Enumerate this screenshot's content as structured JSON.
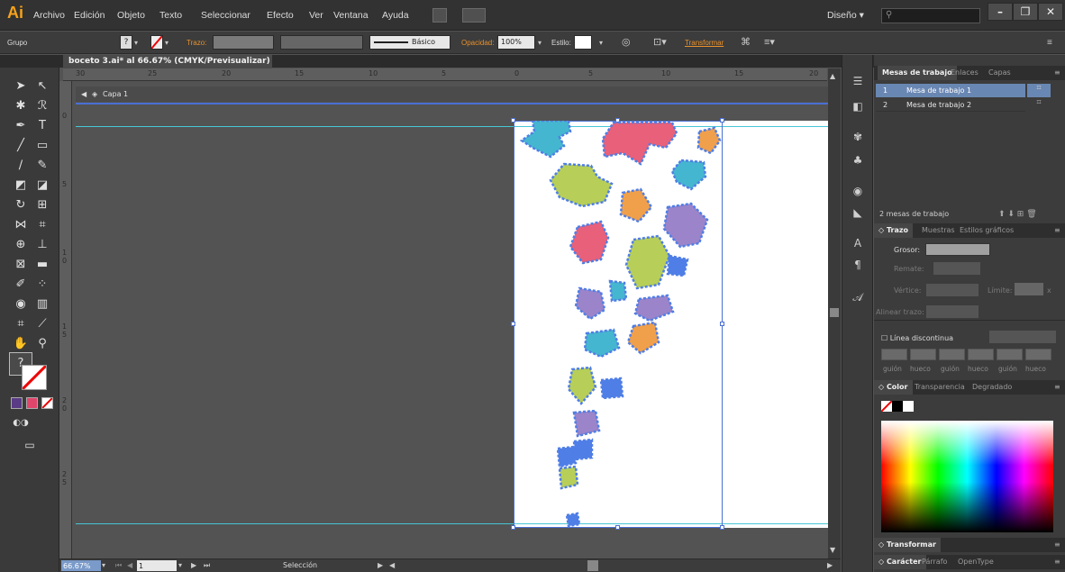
{
  "app": {
    "logo": "Ai",
    "workspace": "Diseño",
    "search_placeholder": ""
  },
  "menu": [
    "Archivo",
    "Edición",
    "Objeto",
    "Texto",
    "Seleccionar",
    "Efecto",
    "Ver",
    "Ventana",
    "Ayuda"
  ],
  "window_controls": {
    "minimize": "–",
    "restore": "❐",
    "close": "✕"
  },
  "control_bar": {
    "selection_label": "Grupo",
    "stroke_label": "Trazo:",
    "brush_label": "Básico",
    "opacity_label": "Opacidad:",
    "opacity_value": "100%",
    "style_label": "Estilo:",
    "transform_label": "Transformar"
  },
  "document": {
    "tab_title": "boceto 3.ai* al 66.67% (CMYK/Previsualizar)",
    "tab_close": "×",
    "layer_name": "Capa 1"
  },
  "rulers": {
    "h_ticks": [
      "30",
      "25",
      "20",
      "15",
      "10",
      "5",
      "0",
      "5",
      "10",
      "15",
      "20"
    ],
    "v_ticks": [
      "0",
      "5",
      "1 0",
      "1 5",
      "2 0",
      "2 5"
    ]
  },
  "status": {
    "zoom": "66.67%",
    "artboard_number": "1",
    "tool": "Selección"
  },
  "artboards_panel": {
    "tabs": [
      "Mesas de trabajo",
      "Enlaces",
      "Capas"
    ],
    "items": [
      {
        "num": "1",
        "name": "Mesa de trabajo 1"
      },
      {
        "num": "2",
        "name": "Mesa de trabajo 2"
      }
    ],
    "count_text": "2 mesas de trabajo"
  },
  "stroke_panel": {
    "tabs": [
      "Trazo",
      "Muestras",
      "Estilos gráficos"
    ],
    "weight_label": "Grosor:",
    "cap_label": "Remate:",
    "corner_label": "Vértice:",
    "limit_label": "Límite:",
    "limit_unit": "x",
    "align_label": "Alinear trazo:",
    "dashed_label": "Línea discontinua",
    "dash_labels": [
      "guión",
      "hueco",
      "guión",
      "hueco",
      "guión",
      "hueco"
    ]
  },
  "color_panel": {
    "tabs": [
      "Color",
      "Transparencia",
      "Degradado"
    ]
  },
  "collapsed_panels": {
    "transform": "Transformar",
    "character_tabs": [
      "Carácter",
      "Párrafo",
      "OpenType"
    ]
  },
  "colors": {
    "accent": "#f7a21b",
    "selection": "#6987b3",
    "puzzle_pink": "#e8607a",
    "puzzle_green": "#b7cf58",
    "puzzle_blue": "#4f7ee6",
    "puzzle_orange": "#f0a04b",
    "puzzle_teal": "#45b6cf",
    "puzzle_purple": "#9b84c9",
    "guide": "#47c6d6"
  }
}
